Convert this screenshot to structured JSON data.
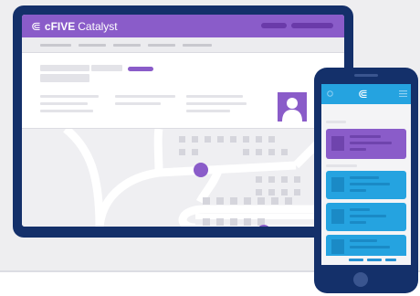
{
  "app": {
    "brand_name": "cFIVE",
    "brand_suffix": "Catalyst",
    "logo_icon": "⋐"
  },
  "colors": {
    "device_frame": "#14306a",
    "tablet_header": "#8a5cc9",
    "phone_header": "#25a3e0",
    "phone_card_selected": "#8a5cc9",
    "phone_card": "#25a3e0",
    "map_background": "#efeff2",
    "map_pin": "#8a5cc9"
  },
  "icons": {
    "tablet": [
      "cfive-logo-icon",
      "user-avatar-icon",
      "map-pin-icon",
      "map-pin-icon"
    ],
    "phone": [
      "back-icon",
      "cfive-logo-icon",
      "menu-icon",
      "home-button"
    ]
  }
}
